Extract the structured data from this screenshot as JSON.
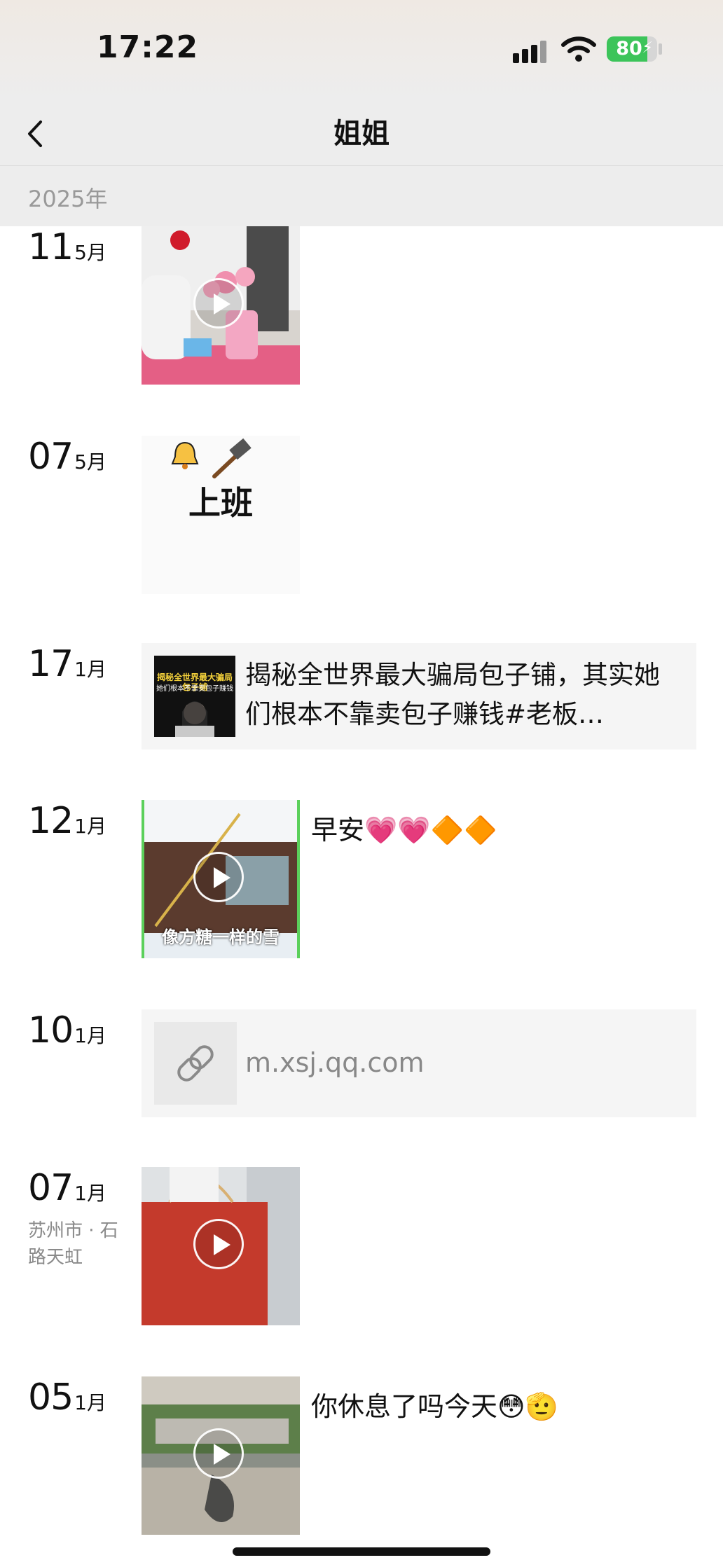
{
  "status_bar": {
    "time": "17:22",
    "battery": "80",
    "battery_level": 0.8
  },
  "nav": {
    "title": "姐姐",
    "back_icon": "chevron-left-icon"
  },
  "year_header": "2025年",
  "entries": [
    {
      "day": "11",
      "month": "5月",
      "type": "video"
    },
    {
      "day": "07",
      "month": "5月",
      "type": "image",
      "image_text": "上班"
    },
    {
      "day": "17",
      "month": "1月",
      "type": "share",
      "share_text": "揭秘全世界最大骗局包子铺，其实她们根本不靠卖包子赚钱#老板…",
      "thumb_title": "揭秘全世界最大骗局包子铺",
      "thumb_subtitle": "她们根本不靠卖包子赚钱"
    },
    {
      "day": "12",
      "month": "1月",
      "type": "video",
      "caption": "早安💗💗🔶🔶",
      "video_subtitle": "像方糖一样的雪"
    },
    {
      "day": "10",
      "month": "1月",
      "type": "link",
      "link": "m.xsj.qq.com",
      "link_icon": "link-icon"
    },
    {
      "day": "07",
      "month": "1月",
      "type": "video",
      "location": "苏州市 · 石路天虹"
    },
    {
      "day": "05",
      "month": "1月",
      "type": "video",
      "caption": "你休息了吗今天😳🫡"
    }
  ],
  "colors": {
    "accent_battery": "#3cc45a",
    "header_bg": "#ededed",
    "card_bg": "#f5f5f5"
  }
}
